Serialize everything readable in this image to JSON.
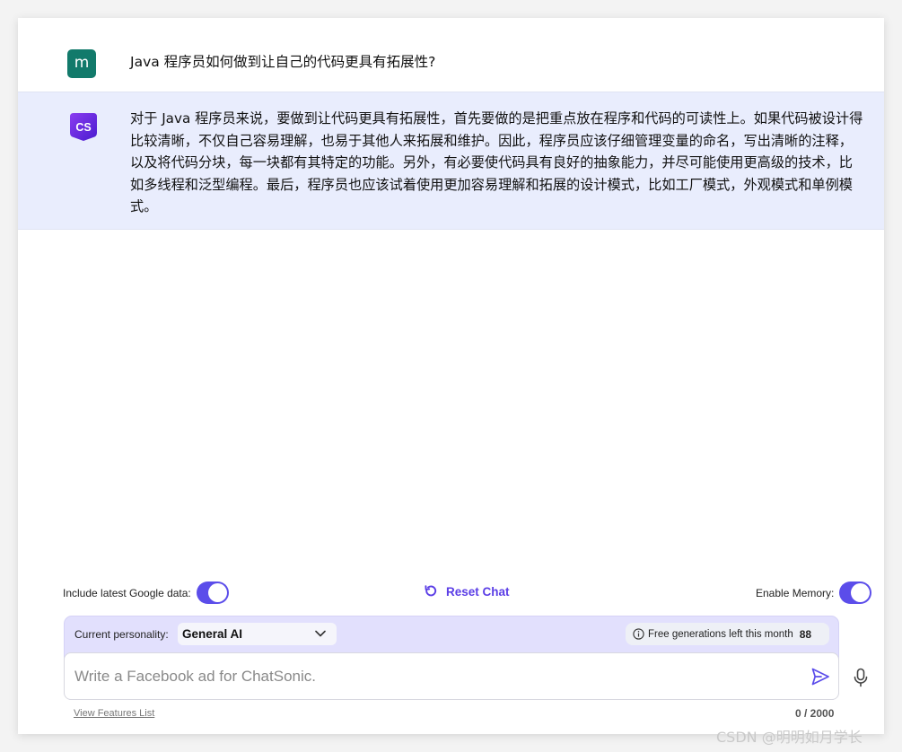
{
  "conversation": {
    "user_avatar_letter": "m",
    "user_message": "Java 程序员如何做到让自己的代码更具有拓展性?",
    "bot_avatar_text": "CS",
    "bot_message": "对于 Java 程序员来说，要做到让代码更具有拓展性，首先要做的是把重点放在程序和代码的可读性上。如果代码被设计得比较清晰，不仅自己容易理解，也易于其他人来拓展和维护。因此，程序员应该仔细管理变量的命名，写出清晰的注释，以及将代码分块，每一块都有其特定的功能。另外，有必要使代码具有良好的抽象能力，并尽可能使用更高级的技术，比如多线程和泛型编程。最后，程序员也应该试着使用更加容易理解和拓展的设计模式，比如工厂模式，外观模式和单例模式。"
  },
  "controls": {
    "google_data_label": "Include latest Google data:",
    "google_data_on": true,
    "reset_label": "Reset Chat",
    "memory_label": "Enable Memory:",
    "memory_on": true
  },
  "composer": {
    "personality_label": "Current personality:",
    "personality_value": "General AI",
    "free_gen_label": "Free generations left this month",
    "free_gen_count": "88",
    "input_placeholder": "Write a Facebook ad for ChatSonic.",
    "char_count": "0 / 2000",
    "features_link": "View Features List"
  },
  "icons": {
    "reset": "reset-icon",
    "chevron": "chevron-down-icon",
    "info": "info-icon",
    "send": "send-icon",
    "mic": "microphone-icon"
  },
  "colors": {
    "accent": "#5b4dea",
    "user_avatar": "#127a6b",
    "bot_row_bg": "#e9edfd",
    "composer_bg": "#e2e0fd"
  },
  "watermark": "CSDN @明明如月学长"
}
